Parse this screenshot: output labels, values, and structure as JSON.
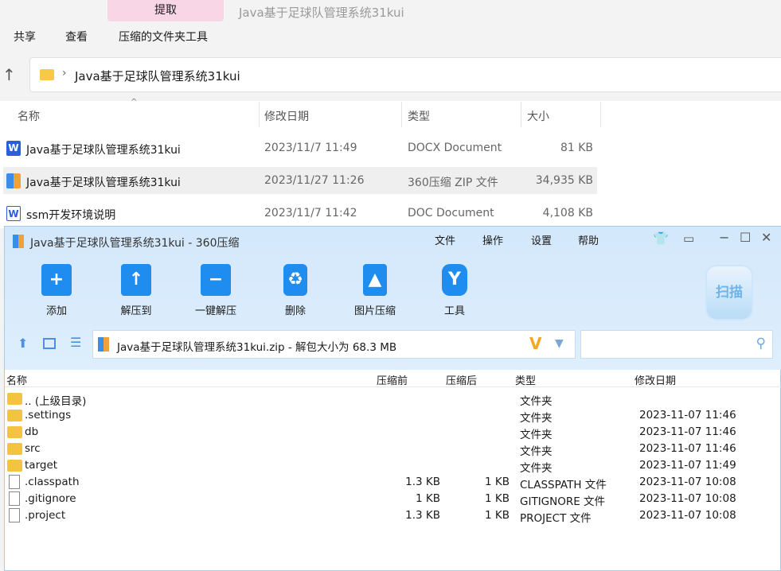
{
  "ribbon": {
    "extract_tab": "提取",
    "window_title": "Java基于足球队管理系统31kui",
    "menus": [
      "共享",
      "查看",
      "压缩的文件夹工具"
    ]
  },
  "address": {
    "path": "Java基于足球队管理系统31kui"
  },
  "explorer": {
    "columns": [
      "名称",
      "修改日期",
      "类型",
      "大小"
    ],
    "files": [
      {
        "name": "Java基于足球队管理系统31kui",
        "date": "2023/11/7 11:49",
        "type": "DOCX Document",
        "size": "81 KB",
        "icon": "word-icon"
      },
      {
        "name": "Java基于足球队管理系统31kui",
        "date": "2023/11/27 11:26",
        "type": "360压缩 ZIP 文件",
        "size": "34,935 KB",
        "icon": "zip-icon"
      },
      {
        "name": "ssm开发环境说明",
        "date": "2023/11/7 11:42",
        "type": "DOC Document",
        "size": "4,108 KB",
        "icon": "word-icon"
      }
    ]
  },
  "zip": {
    "title": "Java基于足球队管理系统31kui - 360压缩",
    "menu": [
      "文件",
      "操作",
      "设置",
      "帮助"
    ],
    "toolbar": [
      "添加",
      "解压到",
      "一键解压",
      "删除",
      "图片压缩",
      "工具"
    ],
    "scan": "扫描",
    "path": "Java基于足球队管理系统31kui.zip - 解包大小为 68.3 MB",
    "columns": [
      "名称",
      "压缩前",
      "压缩后",
      "类型",
      "修改日期"
    ],
    "rows": [
      {
        "name": ".. (上级目录)",
        "before": "",
        "after": "",
        "type": "文件夹",
        "date": "",
        "folder": true
      },
      {
        "name": ".settings",
        "before": "",
        "after": "",
        "type": "文件夹",
        "date": "2023-11-07 11:46",
        "folder": true
      },
      {
        "name": "db",
        "before": "",
        "after": "",
        "type": "文件夹",
        "date": "2023-11-07 11:46",
        "folder": true
      },
      {
        "name": "src",
        "before": "",
        "after": "",
        "type": "文件夹",
        "date": "2023-11-07 11:46",
        "folder": true
      },
      {
        "name": "target",
        "before": "",
        "after": "",
        "type": "文件夹",
        "date": "2023-11-07 11:49",
        "folder": true
      },
      {
        "name": ".classpath",
        "before": "1.3 KB",
        "after": "1 KB",
        "type": "CLASSPATH 文件",
        "date": "2023-11-07 10:08",
        "folder": false
      },
      {
        "name": ".gitignore",
        "before": "1 KB",
        "after": "1 KB",
        "type": "GITIGNORE 文件",
        "date": "2023-11-07 10:08",
        "folder": false
      },
      {
        "name": ".project",
        "before": "1.3 KB",
        "after": "1 KB",
        "type": "PROJECT 文件",
        "date": "2023-11-07 10:08",
        "folder": false
      }
    ]
  }
}
